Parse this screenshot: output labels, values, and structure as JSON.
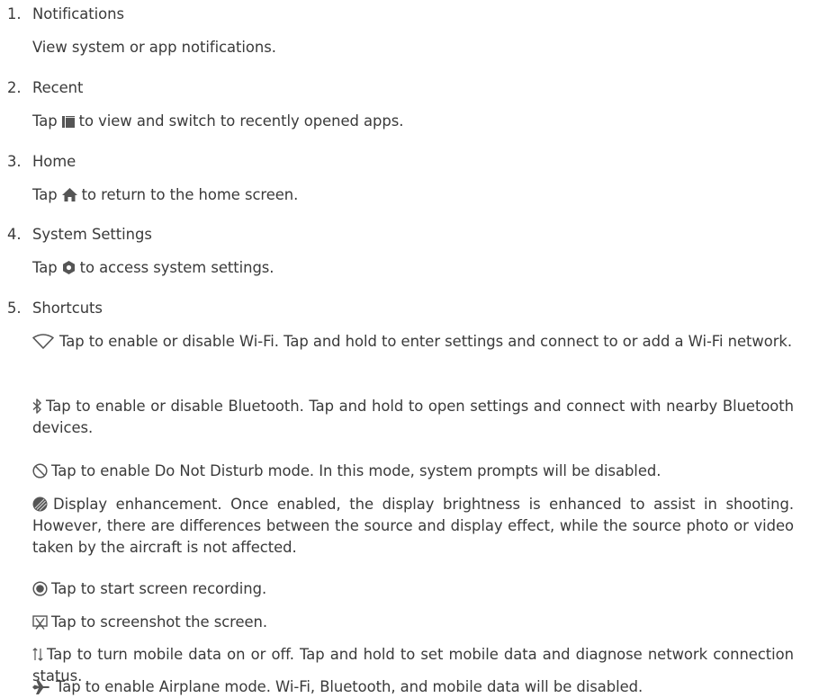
{
  "items": [
    {
      "number": "1.",
      "title": "Notifications",
      "desc": "View system or app notifications."
    },
    {
      "number": "2.",
      "title": "Recent",
      "desc_pre": "Tap",
      "desc_post": "to view and switch to recently opened apps."
    },
    {
      "number": "3.",
      "title": "Home",
      "desc_pre": "Tap",
      "desc_post": "to return to the home screen."
    },
    {
      "number": "4.",
      "title": "System Settings",
      "desc_pre": "Tap",
      "desc_post": "to access system settings."
    },
    {
      "number": "5.",
      "title": "Shortcuts"
    }
  ],
  "shortcuts": [
    {
      "icon": "wifi-icon",
      "text": "Tap to enable or disable Wi-Fi. Tap and hold to enter settings and connect to or add a Wi-Fi network."
    },
    {
      "icon": "bluetooth-icon",
      "text": "Tap to enable or disable Bluetooth. Tap and hold to open settings and connect with nearby Bluetooth devices."
    },
    {
      "icon": "do-not-disturb-icon",
      "text": "Tap to enable Do Not Disturb mode. In this mode, system prompts will be disabled."
    },
    {
      "icon": "display-enhancement-icon",
      "text": "Display enhancement. Once enabled, the display brightness is enhanced to assist in shooting. However, there are differences between the source and display effect, while the source photo or video taken by the aircraft is not affected."
    },
    {
      "icon": "screen-record-icon",
      "text": "Tap to start screen recording."
    },
    {
      "icon": "screenshot-icon",
      "text": "Tap to screenshot the screen."
    },
    {
      "icon": "mobile-data-icon",
      "text": "Tap to turn mobile data on or off. Tap and hold to set mobile data and diagnose network connection status."
    },
    {
      "icon": "airplane-icon",
      "text": "Tap to enable Airplane mode. Wi-Fi, Bluetooth, and mobile data will be disabled."
    }
  ],
  "colors": {
    "text": "#3a3a3a",
    "icon": "#555555"
  }
}
